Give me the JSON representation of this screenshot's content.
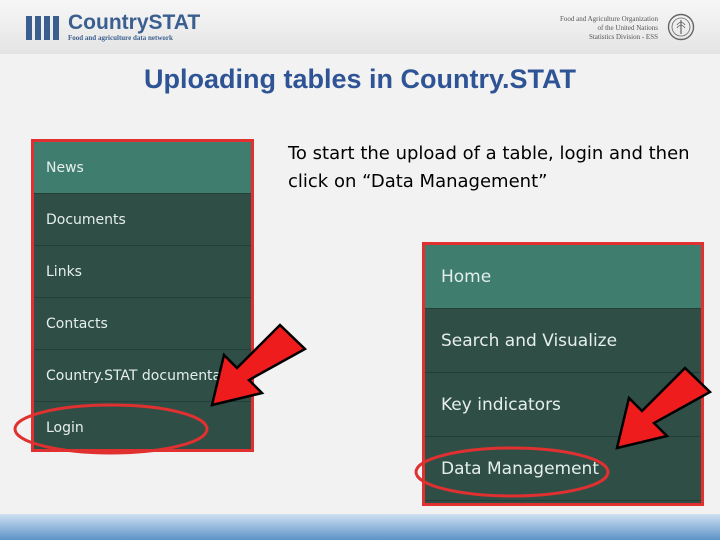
{
  "header": {
    "logo_title": "CountrySTAT",
    "logo_subtitle": "Food and agriculture data network",
    "org_lines": [
      "Food and Agriculture Organization",
      "of the United Nations",
      "Statistics Division - ESS"
    ],
    "logo_color": "#3a5f8f"
  },
  "slide": {
    "title": "Uploading tables in Country.STAT",
    "instruction": "To start the upload of a table, login and then click on “Data Management”"
  },
  "left_menu": {
    "items": [
      {
        "label": "News",
        "active": true
      },
      {
        "label": "Documents",
        "active": false
      },
      {
        "label": "Links",
        "active": false
      },
      {
        "label": "Contacts",
        "active": false
      },
      {
        "label": "Country.STAT documentation",
        "active": false
      },
      {
        "label": "Login",
        "active": false
      }
    ]
  },
  "right_menu": {
    "items": [
      {
        "label": "Home",
        "active": true
      },
      {
        "label": "Search and Visualize",
        "active": false
      },
      {
        "label": "Key indicators",
        "active": false
      },
      {
        "label": "Data Management",
        "active": false
      }
    ]
  },
  "colors": {
    "menu_bg": "#2f4f46",
    "menu_active": "#3f7e6f",
    "highlight_red": "#e03030",
    "title_blue": "#2f5496"
  }
}
